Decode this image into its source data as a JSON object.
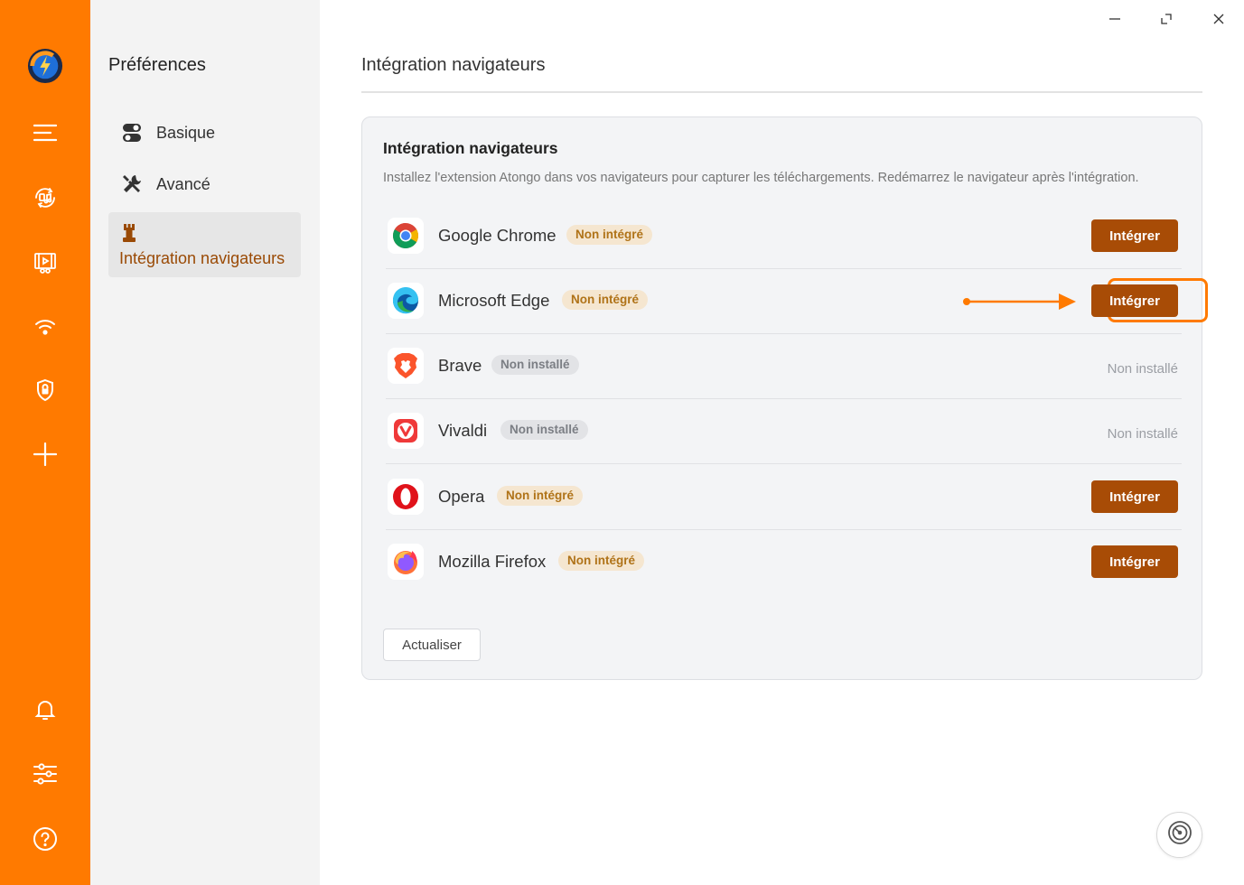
{
  "colors": {
    "accent": "#FF7A00",
    "button": "#A84C06",
    "active_label": "#9A4A05"
  },
  "sidebar": {
    "icons": [
      "app-logo-icon",
      "menu-icon",
      "music-convert-icon",
      "video-convert-icon",
      "wifi-icon",
      "shield-icon",
      "plus-icon",
      "bell-icon",
      "sliders-icon",
      "help-icon"
    ]
  },
  "preferences": {
    "title": "Préférences",
    "items": [
      {
        "label": "Basique",
        "icon": "toggle-icon"
      },
      {
        "label": "Avancé",
        "icon": "tools-icon"
      },
      {
        "label": "Intégration navigateurs",
        "icon": "chess-rook-icon",
        "active": true
      }
    ]
  },
  "window": {
    "controls": [
      "minimize-icon",
      "restore-icon",
      "close-icon"
    ]
  },
  "main": {
    "title": "Intégration navigateurs",
    "card": {
      "title": "Intégration navigateurs",
      "description": "Installez l'extension Atongo dans vos navigateurs pour capturer les téléchargements. Redémarrez le navigateur après l'intégration.",
      "browsers": [
        {
          "name": "Google Chrome",
          "badge": "Non intégré",
          "action": "Intégrer",
          "icon": "chrome-icon"
        },
        {
          "name": "Microsoft Edge",
          "badge": "Non intégré",
          "action": "Intégrer",
          "icon": "edge-icon",
          "highlighted": true
        },
        {
          "name": "Brave",
          "badge": "Non installé",
          "status": "Non installé",
          "icon": "brave-icon"
        },
        {
          "name": "Vivaldi",
          "badge": "Non installé",
          "status": "Non installé",
          "icon": "vivaldi-icon"
        },
        {
          "name": "Opera",
          "badge": "Non intégré",
          "action": "Intégrer",
          "icon": "opera-icon"
        },
        {
          "name": "Mozilla Firefox",
          "badge": "Non intégré",
          "action": "Intégrer",
          "icon": "firefox-icon"
        }
      ],
      "refresh_label": "Actualiser"
    }
  },
  "footer": {
    "speed_icon": "speedometer-icon"
  }
}
